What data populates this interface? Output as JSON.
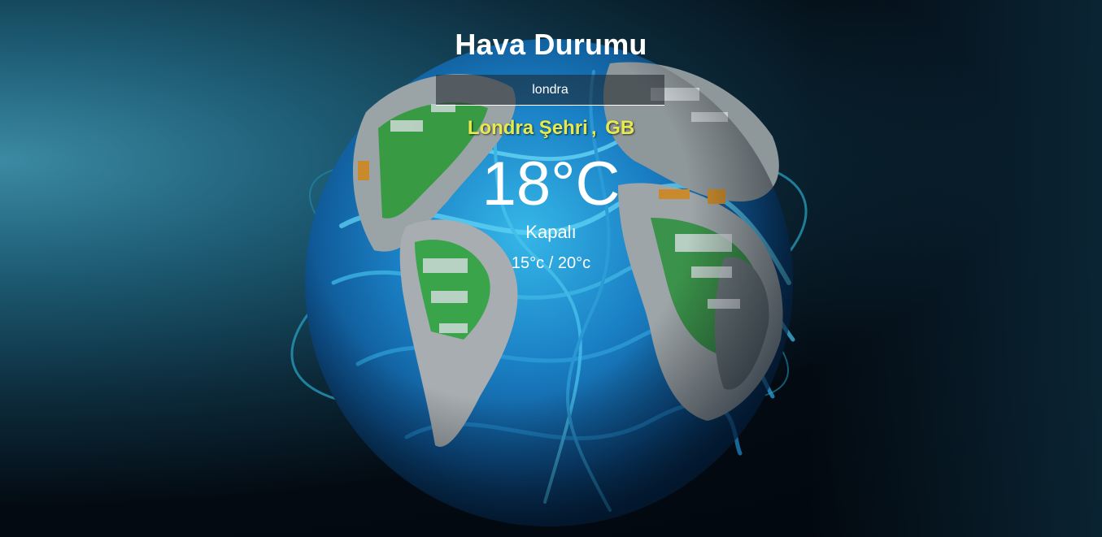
{
  "app": {
    "title": "Hava Durumu"
  },
  "search": {
    "value": "londra",
    "placeholder": ""
  },
  "location": {
    "city": "Londra Şehri",
    "separator": ",",
    "country": "GB"
  },
  "weather": {
    "temperature": "18°C",
    "condition": "Kapalı",
    "min_max": "15°c / 20°c"
  },
  "colors": {
    "city_text": "#e7ea4e",
    "text": "#ffffff",
    "background_dark": "#02070d",
    "background_teal": "#3b8aa3"
  },
  "background": {
    "image": "globe-circuit-image"
  }
}
